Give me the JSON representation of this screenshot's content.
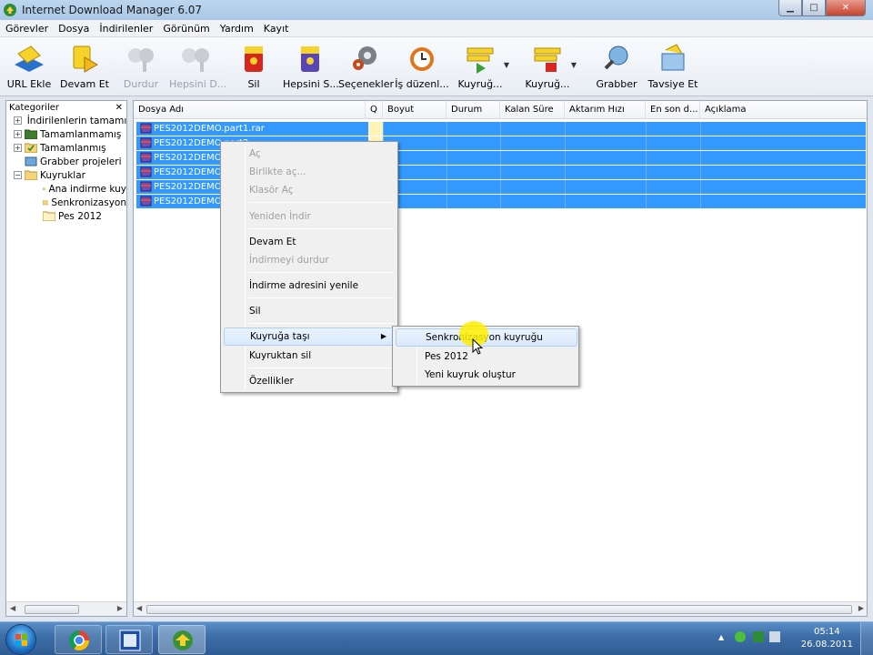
{
  "window": {
    "title": "Internet Download Manager 6.07"
  },
  "menubar": [
    "Görevler",
    "Dosya",
    "İndirilenler",
    "Görünüm",
    "Yardım",
    "Kayıt"
  ],
  "toolbar": {
    "url_ekle": "URL Ekle",
    "devam_et": "Devam Et",
    "durdur": "Durdur",
    "hepsini_durdur": "Hepsini D...",
    "sil": "Sil",
    "hepsini_sil": "Hepsini S...",
    "secenekler": "Seçenekler",
    "is_duzenleyici": "İş düzenl...",
    "kuyrugu_baslat": "Kuyruğ...",
    "kuyrugu_durdur": "Kuyruğ...",
    "grabber": "Grabber",
    "tavsiye_et": "Tavsiye Et"
  },
  "categories": {
    "header": "Kategoriler",
    "items": [
      "İndirilenlerin tamamı",
      "Tamamlanmamış",
      "Tamamlanmış",
      "Grabber projeleri",
      "Kuyruklar",
      "Ana indirme kuy",
      "Senkronizasyon",
      "Pes 2012"
    ]
  },
  "columns": [
    "Dosya Adı",
    "Q",
    "Boyut",
    "Durum",
    "Kalan Süre",
    "Aktarım Hızı",
    "En son d...",
    "Açıklama"
  ],
  "files": [
    "PES2012DEMO.part1.rar",
    "PES2012DEMO.part2",
    "PES2012DEMO.p",
    "PES2012DEMO.p",
    "PES2012DEMO.p",
    "PES2012DEMO.p"
  ],
  "context_menu": {
    "ac": "Aç",
    "birlikte_ac": "Birlikte aç...",
    "klasor_ac": "Klasör Aç",
    "yeniden_indir": "Yeniden İndir",
    "devam_et": "Devam Et",
    "indirmeyi_durdur": "İndirmeyi durdur",
    "adresi_yenile": "İndirme adresini yenile",
    "sil": "Sil",
    "kuyruga_tasi": "Kuyruğa taşı",
    "kuyruktan_sil": "Kuyruktan sil",
    "ozellikler": "Özellikler"
  },
  "submenu": {
    "senkronizasyon": "Senkronizasyon kuyruğu",
    "pes2012": "Pes 2012",
    "yeni_kuyruk": "Yeni kuyruk oluştur"
  },
  "taskbar": {
    "time": "05:14",
    "date": "26.08.2011"
  }
}
